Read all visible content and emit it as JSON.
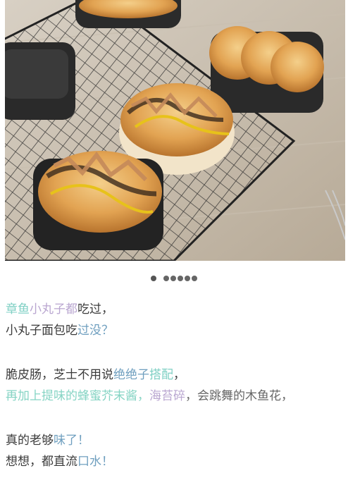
{
  "photo": {
    "alt": "hot dog buns topped with bonito flakes and seaweed on a cooling rack"
  },
  "carousel": {
    "total_dots": 6,
    "active_index": 0
  },
  "colors": {
    "teal": "#7fd0c4",
    "lilac": "#b9a6d0",
    "blue": "#6f9fbf",
    "dark": "#3b3b3b"
  },
  "article": {
    "line1": {
      "seg1": "章鱼",
      "seg2": "小丸子",
      "seg3": "都",
      "seg4": "吃过，"
    },
    "line2": {
      "seg1": "小丸子面包吃",
      "seg2": "过没？"
    },
    "line3": {
      "seg1": "脆皮肠，芝士不用说",
      "seg2": "绝绝子",
      "seg3": "搭配",
      "seg4": "，"
    },
    "line4": {
      "seg1": "再加上提味的蜂蜜芥末酱，",
      "seg2": "海苔碎",
      "seg3": "，会跳舞的木鱼花，"
    },
    "line5": {
      "seg1": "真的老够",
      "seg2": "味了！"
    },
    "line6": {
      "seg1": "想想，都直流",
      "seg2": "口水！"
    }
  }
}
